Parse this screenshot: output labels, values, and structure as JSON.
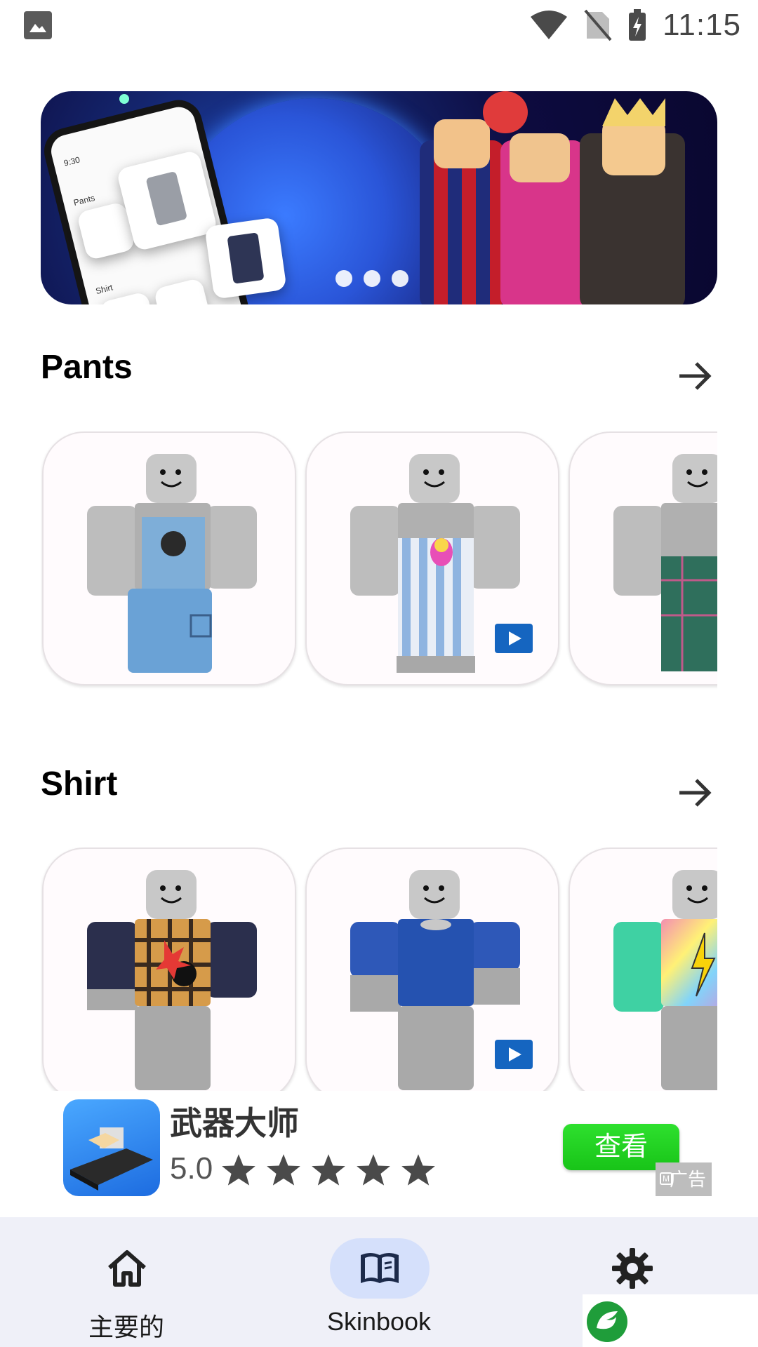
{
  "status_bar": {
    "time": "11:15",
    "icons": [
      "gallery-icon",
      "wifi-icon",
      "no-sim-icon",
      "battery-charging-icon"
    ]
  },
  "banner": {
    "carousel_dots": 3,
    "phone_labels": {
      "time": "9:30",
      "section1": "Pants",
      "section2": "Shirt"
    }
  },
  "sections": [
    {
      "title": "Pants",
      "more_icon": "arrow-right-icon"
    },
    {
      "title": "Shirt",
      "more_icon": "arrow-right-icon"
    }
  ],
  "ad": {
    "app_name": "武器大师",
    "rating": "5.0",
    "stars": 5,
    "cta_label": "查看",
    "ad_label": "广告"
  },
  "bottom_nav": {
    "items": [
      {
        "label": "主要的",
        "icon": "home-icon",
        "selected": false
      },
      {
        "label": "Skinbook",
        "icon": "book-icon",
        "selected": true
      },
      {
        "label": "",
        "icon": "gear-icon",
        "selected": false
      }
    ]
  },
  "colors": {
    "nav_background": "#eff0f8",
    "nav_selected_pill": "#d5e0fb",
    "cta_green": "#18c418",
    "play_badge": "#1565c0"
  }
}
